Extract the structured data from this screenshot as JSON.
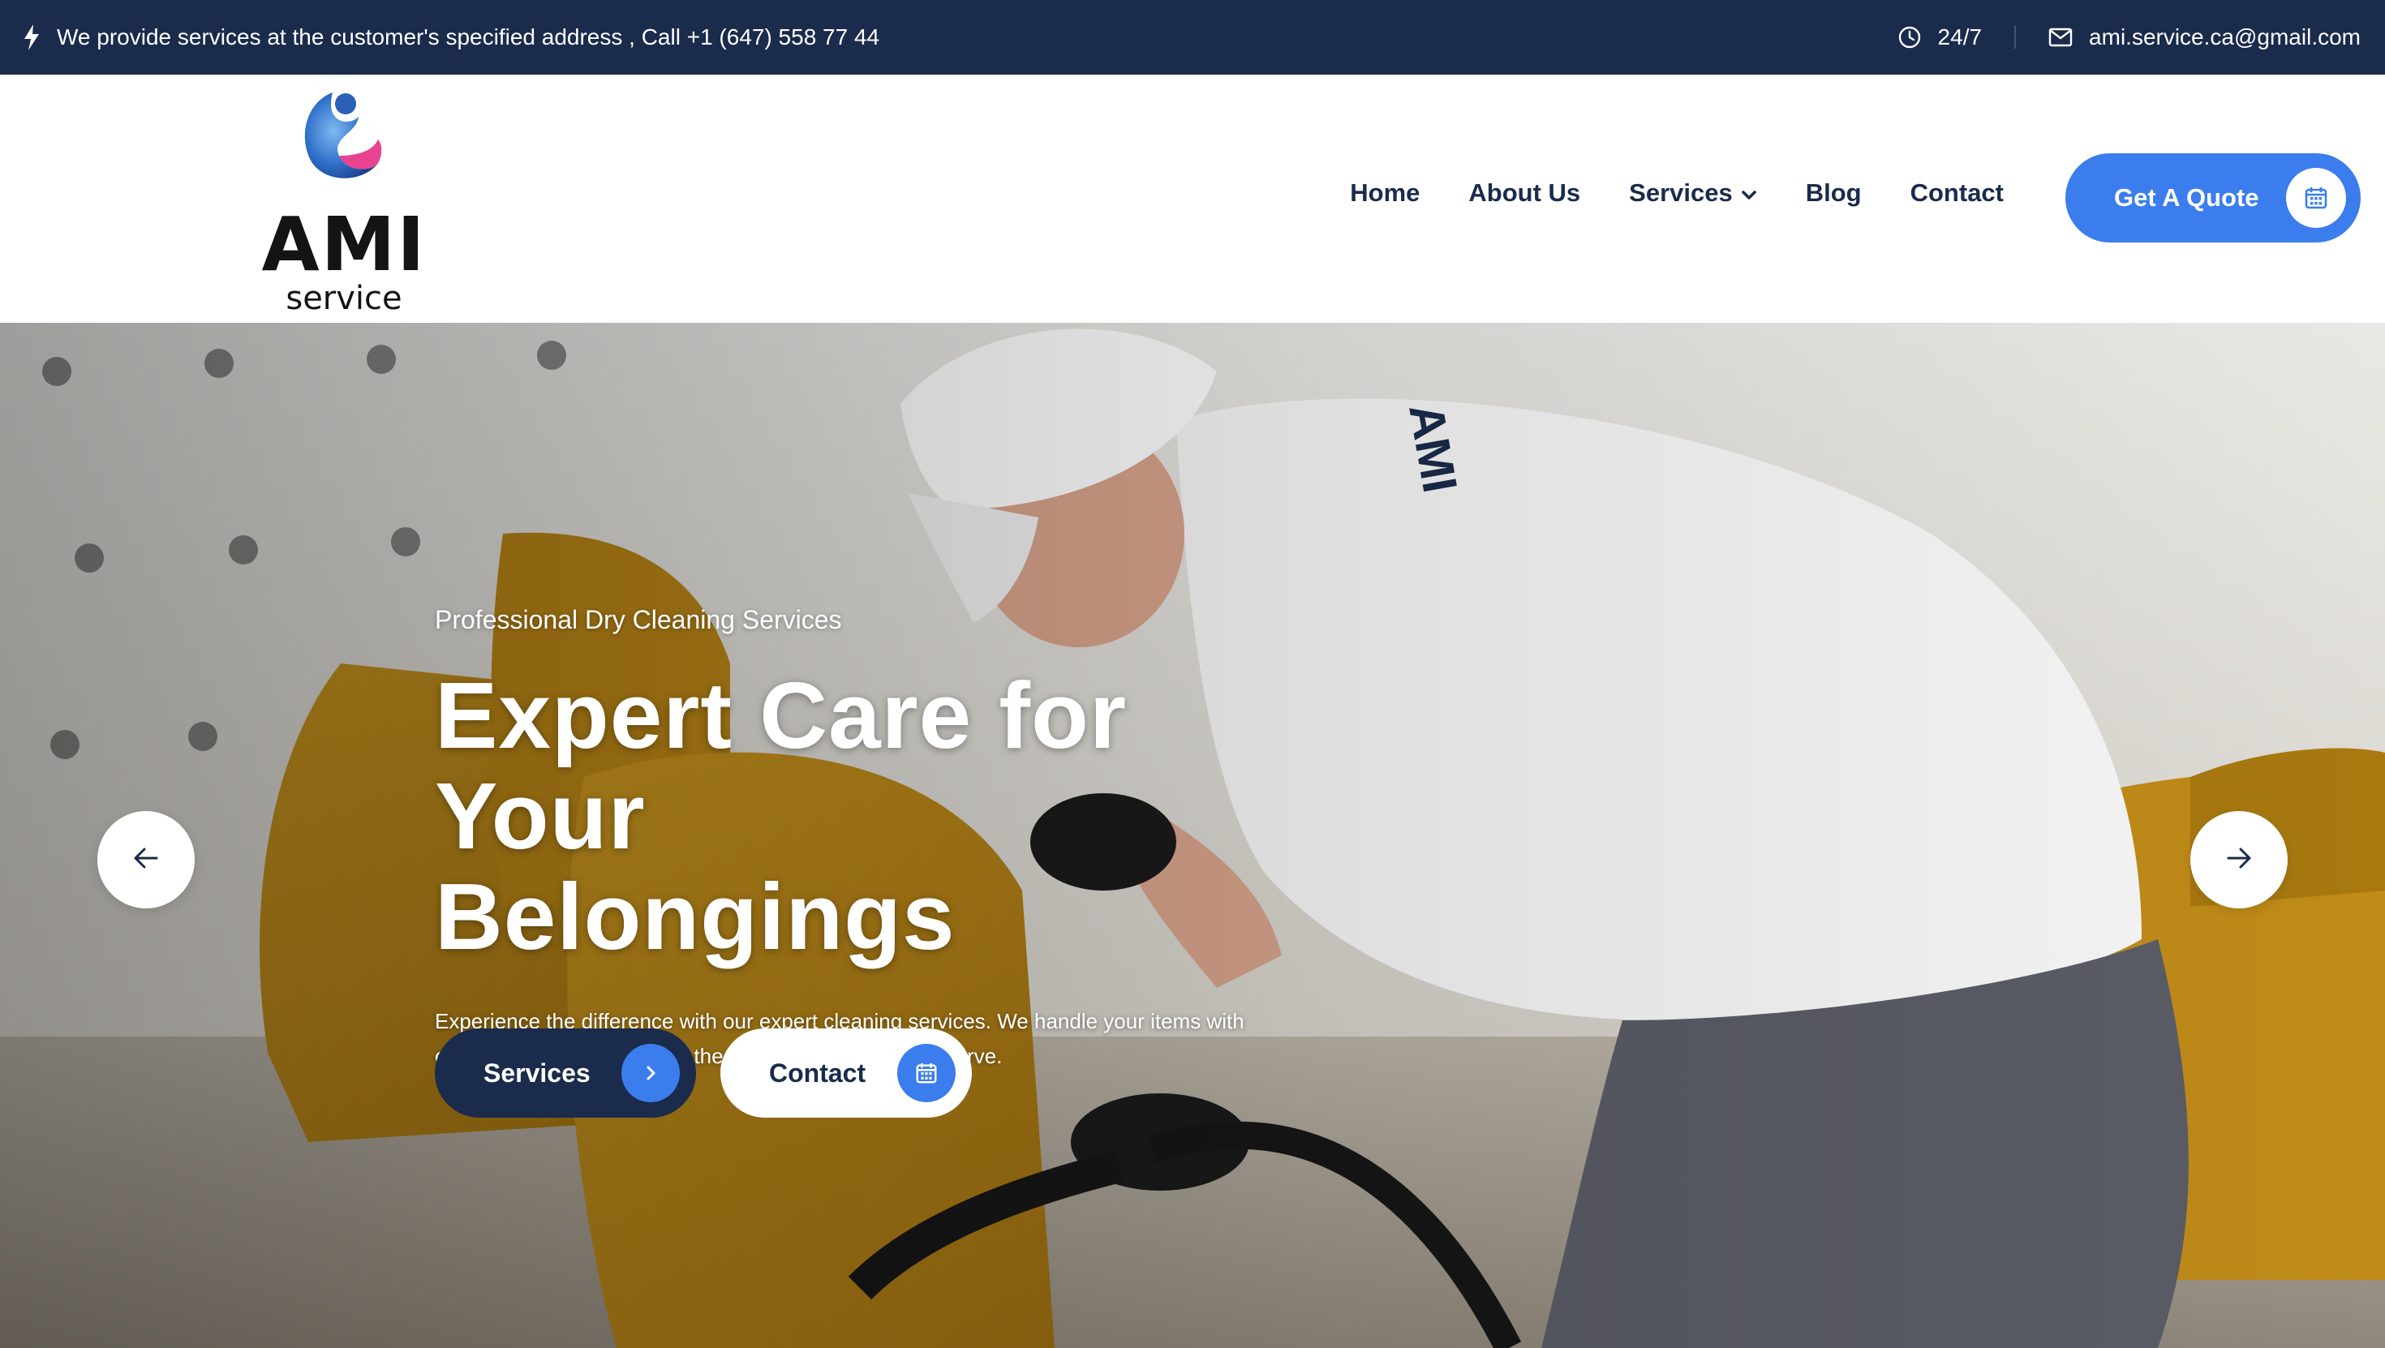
{
  "colors": {
    "navy": "#1a2b4c",
    "accent": "#3b7ded",
    "white": "#ffffff"
  },
  "topbar": {
    "announcement": "We provide services at the customer's specified address , Call +1 (647) 558 77 44",
    "hours": "24/7",
    "email": "ami.service.ca@gmail.com",
    "icons": [
      "bolt-icon",
      "clock-icon",
      "mail-icon"
    ]
  },
  "logo": {
    "wordmark": "AMI",
    "subword": "service"
  },
  "nav": {
    "items": [
      {
        "label": "Home"
      },
      {
        "label": "About Us"
      },
      {
        "label": "Services",
        "has_dropdown": true
      },
      {
        "label": "Blog"
      },
      {
        "label": "Contact"
      }
    ],
    "cta_label": "Get A Quote",
    "cta_icon": "calendar-icon"
  },
  "hero": {
    "eyebrow": "Professional Dry Cleaning Services",
    "title_line1": "Expert Care for Your",
    "title_line2": "Belongings",
    "description": "Experience the difference with our expert cleaning services. We handle your items with care, ensuring they receive the royal treatment they deserve.",
    "primary_button": "Services",
    "secondary_button": "Contact",
    "prev_icon": "arrow-left-icon",
    "next_icon": "arrow-right-icon"
  }
}
